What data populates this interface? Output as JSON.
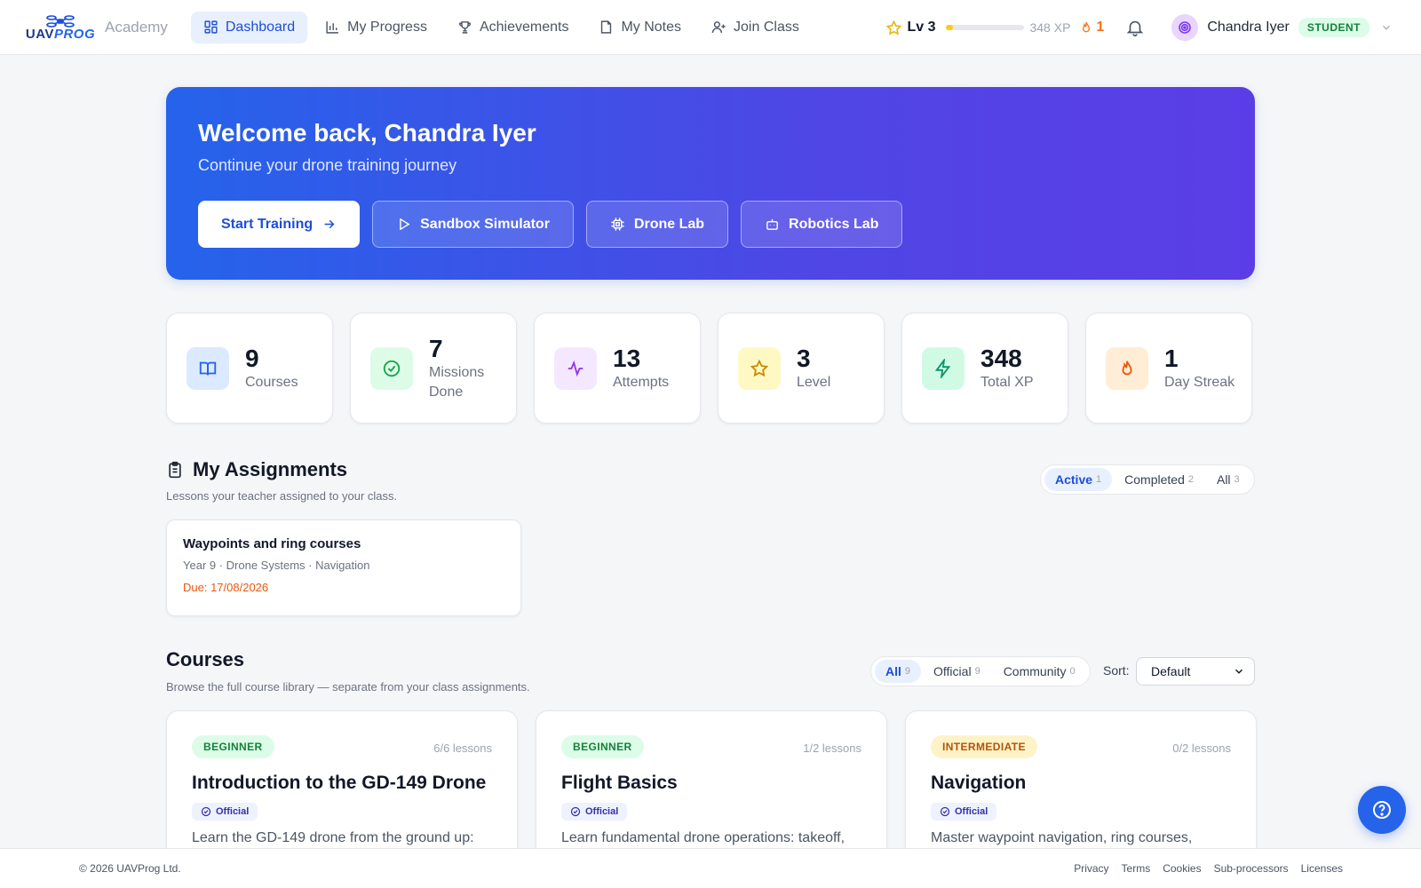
{
  "brand": {
    "logo_prefix": "UAV",
    "logo_suffix": "PROG",
    "academy": "Academy"
  },
  "nav": [
    {
      "label": "Dashboard",
      "icon": "grid-icon",
      "active": true
    },
    {
      "label": "My Progress",
      "icon": "bar-chart-icon",
      "active": false
    },
    {
      "label": "Achievements",
      "icon": "trophy-icon",
      "active": false
    },
    {
      "label": "My Notes",
      "icon": "note-icon",
      "active": false
    },
    {
      "label": "Join Class",
      "icon": "user-plus-icon",
      "active": false
    }
  ],
  "status": {
    "level": "Lv 3",
    "xp": "348 XP",
    "xp_progress": 0.09,
    "streak": "1"
  },
  "user": {
    "name": "Chandra Iyer",
    "role": "STUDENT"
  },
  "hero": {
    "title": "Welcome back, Chandra Iyer",
    "subtitle": "Continue your drone training journey",
    "buttons": [
      "Start Training",
      "Sandbox Simulator",
      "Drone Lab",
      "Robotics Lab"
    ]
  },
  "stats": [
    {
      "value": "9",
      "label": "Courses",
      "icon": "book-icon",
      "color": "#2563eb",
      "bg": "#dbeafe"
    },
    {
      "value": "7",
      "label": "Missions Done",
      "icon": "check-circle-icon",
      "color": "#16a34a",
      "bg": "#dcfce7"
    },
    {
      "value": "13",
      "label": "Attempts",
      "icon": "activity-icon",
      "color": "#9333ea",
      "bg": "#f3e8ff"
    },
    {
      "value": "3",
      "label": "Level",
      "icon": "star-icon",
      "color": "#ca8a04",
      "bg": "#fef9c3"
    },
    {
      "value": "348",
      "label": "Total XP",
      "icon": "bolt-icon",
      "color": "#059669",
      "bg": "#d1fae5"
    },
    {
      "value": "1",
      "label": "Day Streak",
      "icon": "flame-icon",
      "color": "#ea580c",
      "bg": "#ffedd5"
    }
  ],
  "assignments": {
    "title": "My Assignments",
    "subtitle": "Lessons your teacher assigned to your class.",
    "filters": [
      {
        "label": "Active",
        "count": "1",
        "active": true
      },
      {
        "label": "Completed",
        "count": "2",
        "active": false
      },
      {
        "label": "All",
        "count": "3",
        "active": false
      }
    ],
    "items": [
      {
        "title": "Waypoints and ring courses",
        "meta": "Year 9 · Drone Systems · Navigation",
        "due": "Due: 17/08/2026"
      }
    ]
  },
  "courses": {
    "title": "Courses",
    "subtitle": "Browse the full course library — separate from your class assignments.",
    "filters": [
      {
        "label": "All",
        "count": "9",
        "active": true
      },
      {
        "label": "Official",
        "count": "9",
        "active": false
      },
      {
        "label": "Community",
        "count": "0",
        "active": false
      }
    ],
    "sort_label": "Sort:",
    "sort_value": "Default",
    "items": [
      {
        "level": "BEGINNER",
        "lessons": "6/6 lessons",
        "title": "Introduction to the GD-149 Drone",
        "badge": "Official",
        "desc": "Learn the GD-149 drone from the ground up:"
      },
      {
        "level": "BEGINNER",
        "lessons": "1/2 lessons",
        "title": "Flight Basics",
        "badge": "Official",
        "desc": "Learn fundamental drone operations: takeoff,"
      },
      {
        "level": "INTERMEDIATE",
        "lessons": "0/2 lessons",
        "title": "Navigation",
        "badge": "Official",
        "desc": "Master waypoint navigation, ring courses,"
      }
    ]
  },
  "footer": {
    "copyright": "© 2026 UAVProg Ltd.",
    "links": [
      "Privacy",
      "Terms",
      "Cookies",
      "Sub-processors",
      "Licenses"
    ]
  }
}
